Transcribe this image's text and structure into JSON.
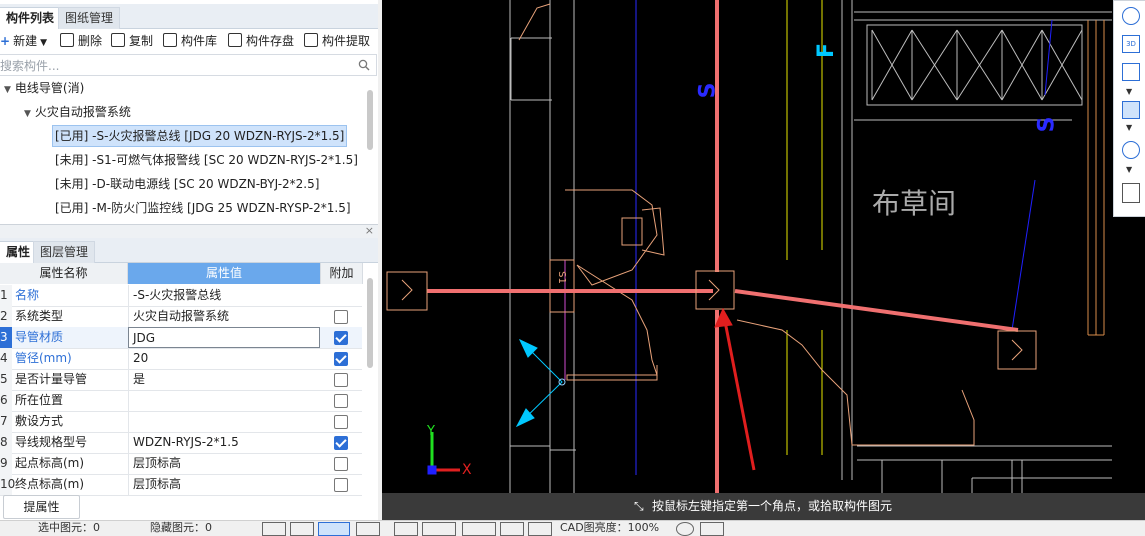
{
  "component_panel": {
    "tabs": [
      "构件列表",
      "图纸管理"
    ],
    "toolbar": {
      "new": "新建",
      "delete": "删除",
      "copy": "复制",
      "library": "构件库",
      "store": "构件存盘",
      "extract": "构件提取"
    },
    "search_placeholder": "搜索构件...",
    "tree": {
      "root": "电线导管(消)",
      "group": "火灾自动报警系统",
      "items": [
        "[已用] -S-火灾报警总线 [JDG 20 WDZN-RYJS-2*1.5]",
        "[未用] -S1-可燃气体报警线 [SC 20 WDZN-RYJS-2*1.5]",
        "[未用] -D-联动电源线 [SC 20 WDZN-BYJ-2*2.5]",
        "[已用] -M-防火门监控线 [JDG 25 WDZN-RYSP-2*1.5]"
      ]
    }
  },
  "property_panel": {
    "tabs": [
      "属性",
      "图层管理"
    ],
    "headers": [
      "属性名称",
      "属性值",
      "附加"
    ],
    "rows": [
      {
        "num": "1",
        "name": "名称",
        "value": "-S-火灾报警总线",
        "checked": null,
        "blue": true
      },
      {
        "num": "2",
        "name": "系统类型",
        "value": "火灾自动报警系统",
        "checked": false,
        "blue": false
      },
      {
        "num": "3",
        "name": "导管材质",
        "value": "JDG",
        "checked": true,
        "blue": true
      },
      {
        "num": "4",
        "name": "管径(mm)",
        "value": "20",
        "checked": true,
        "blue": true
      },
      {
        "num": "5",
        "name": "是否计量导管",
        "value": "是",
        "checked": false,
        "blue": false
      },
      {
        "num": "6",
        "name": "所在位置",
        "value": "",
        "checked": false,
        "blue": false
      },
      {
        "num": "7",
        "name": "敷设方式",
        "value": "",
        "checked": false,
        "blue": false
      },
      {
        "num": "8",
        "name": "导线规格型号",
        "value": "WDZN-RYJS-2*1.5",
        "checked": true,
        "blue": false
      },
      {
        "num": "9",
        "name": "起点标高(m)",
        "value": "层顶标高",
        "checked": false,
        "blue": false
      },
      {
        "num": "10",
        "name": "终点标高(m)",
        "value": "层顶标高",
        "checked": false,
        "blue": false
      }
    ],
    "extract_button": "提属性"
  },
  "canvas": {
    "room_label": "布草间",
    "labels": [
      "S",
      "S",
      "F"
    ],
    "block_label": "S1",
    "axis_x": "X",
    "axis_y": "Y",
    "prompt": "按鼠标左键指定第一个角点，或拾取构件图元"
  },
  "bottom_bar": {
    "selected": "选中图元：0",
    "hidden": "隐藏图元：0",
    "cad_brightness": "CAD图亮度：100%"
  },
  "colors": {
    "accent": "#2d6fd6",
    "canvas_bg": "#000000",
    "pipe": "#f07070",
    "axis_cyan": "#00c8ff"
  }
}
